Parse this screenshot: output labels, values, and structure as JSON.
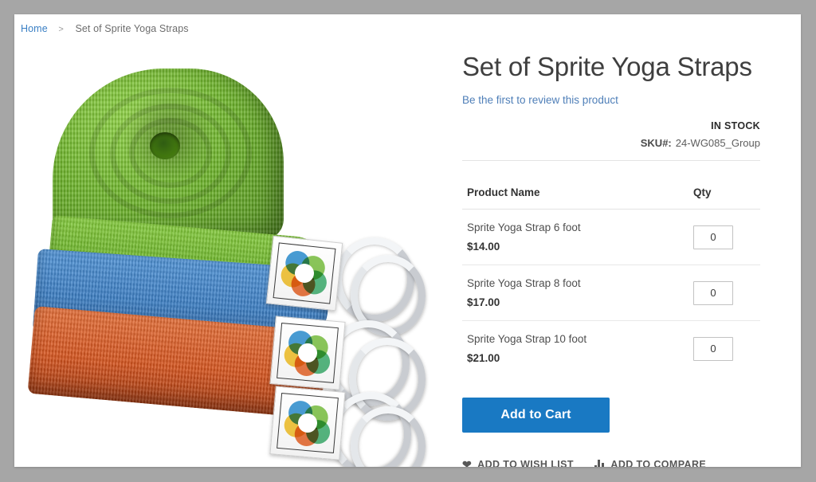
{
  "breadcrumb": {
    "home_label": "Home",
    "separator": ">",
    "current_label": "Set of Sprite Yoga Straps"
  },
  "product": {
    "title": "Set of Sprite Yoga Straps",
    "review_link": "Be the first to review this product",
    "availability": "IN STOCK",
    "sku_label": "SKU#:",
    "sku_value": "24-WG085_Group"
  },
  "grouped_table": {
    "columns": {
      "name": "Product Name",
      "qty": "Qty"
    },
    "rows": [
      {
        "name": "Sprite Yoga Strap 6 foot",
        "price": "$14.00",
        "qty": "0"
      },
      {
        "name": "Sprite Yoga Strap 8 foot",
        "price": "$17.00",
        "qty": "0"
      },
      {
        "name": "Sprite Yoga Strap 10 foot",
        "price": "$21.00",
        "qty": "0"
      }
    ]
  },
  "actions": {
    "add_to_cart": "Add to Cart",
    "wish_list": "ADD TO WISH LIST",
    "compare": "ADD TO COMPARE"
  },
  "colors": {
    "accent_blue": "#1979c3",
    "link_blue": "#4f7fb8",
    "strap_green": "#6cb32a",
    "strap_blue": "#3d7fc4",
    "strap_orange": "#d6551f",
    "page_backdrop": "#a6a6a6"
  },
  "media": {
    "alt": "Set of three rolled Sprite yoga straps in green, blue and orange with D-rings"
  }
}
